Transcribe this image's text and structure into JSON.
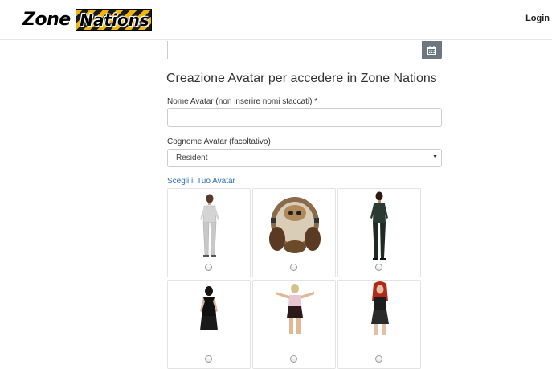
{
  "header": {
    "logo": {
      "part1": "Zone",
      "part2": "Nations"
    },
    "login_label": "Login"
  },
  "form": {
    "calendar_icon": "calendar-icon",
    "heading": "Creazione Avatar per accedere in Zone Nations",
    "first_name_label": "Nome Avatar (non inserire nomi staccati) *",
    "first_name_value": "",
    "last_name_label": "Cognome Avatar (facoltativo)",
    "last_name_selected": "Resident",
    "choose_avatar_label": "Scegli il Tuo Avatar"
  },
  "avatars": [
    {
      "name": "male-grey-outfit",
      "selected": false
    },
    {
      "name": "robot-orb",
      "selected": false
    },
    {
      "name": "male-dark-outfit",
      "selected": false
    },
    {
      "name": "female-black-dress",
      "selected": false
    },
    {
      "name": "female-pink-top",
      "selected": false
    },
    {
      "name": "female-red-hair",
      "selected": false
    }
  ],
  "colors": {
    "link": "#2a6ebb",
    "calendar_button": "#6b7782",
    "logo_stripe_yellow": "#f2b705",
    "logo_stripe_black": "#1a1a1a"
  }
}
